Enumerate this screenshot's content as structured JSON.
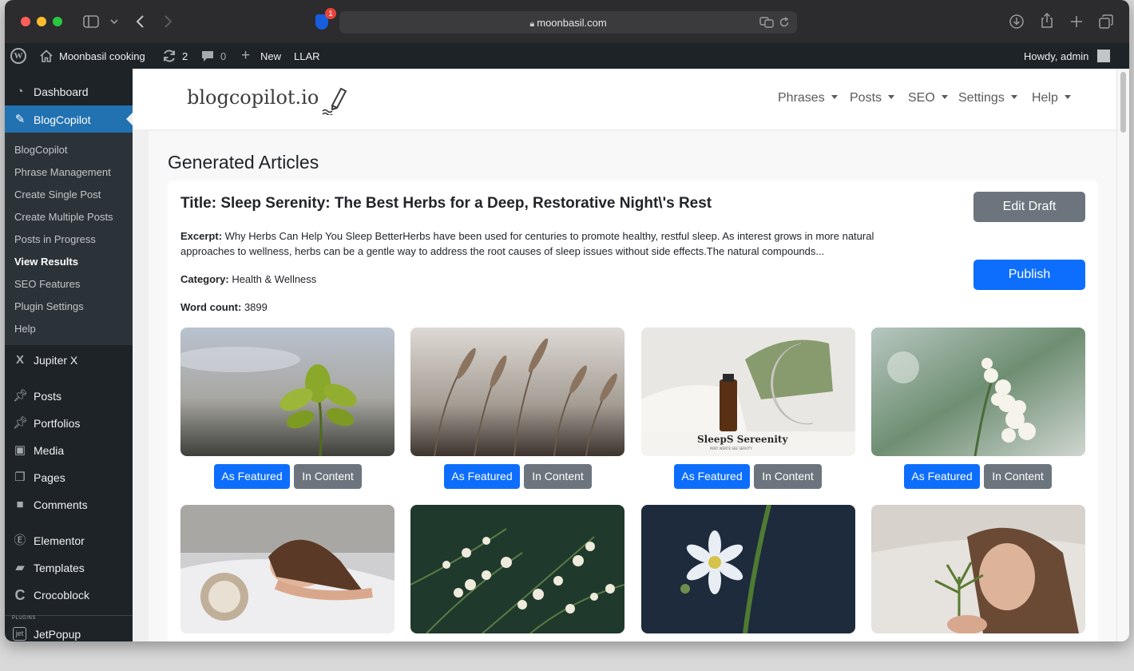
{
  "browser": {
    "url": "moonbasil.com",
    "bitwarden_badge": "1",
    "icons": [
      "sidebar-icon",
      "chevron-down-icon",
      "back-icon",
      "forward-icon",
      "lock-icon",
      "translate-icon",
      "reload-icon",
      "download-icon",
      "share-icon",
      "new-tab-icon",
      "tabs-icon"
    ]
  },
  "adminbar": {
    "site_name": "Moonbasil cooking",
    "updates_count": "2",
    "comments_count": "0",
    "new_label": "New",
    "llar_label": "LLAR",
    "howdy": "Howdy, admin"
  },
  "sidebar": {
    "dashboard": "Dashboard",
    "blogcopilot": "BlogCopilot",
    "submenu": [
      "BlogCopilot",
      "Phrase Management",
      "Create Single Post",
      "Create Multiple Posts",
      "Posts in Progress",
      "View Results",
      "SEO Features",
      "Plugin Settings",
      "Help"
    ],
    "jupiter": "Jupiter X",
    "posts": "Posts",
    "portfolios": "Portfolios",
    "media": "Media",
    "pages": "Pages",
    "comments": "Comments",
    "elementor": "Elementor",
    "templates": "Templates",
    "crocoblock": "Crocoblock",
    "plugins_tag": "PLUGINS",
    "jetpopup": "JetPopup"
  },
  "topnav": {
    "brand": "blogcopilot.io",
    "links": [
      "Phrases",
      "Posts",
      "SEO",
      "Settings",
      "Help"
    ]
  },
  "main": {
    "page_title": "Generated Articles",
    "article": {
      "title": "Title: Sleep Serenity: The Best Herbs for a Deep, Restorative Night\\'s Rest",
      "excerpt_label": "Excerpt:",
      "excerpt": "Why Herbs Can Help You Sleep BetterHerbs have been used for centuries to promote healthy, restful sleep. As interest grows in more natural approaches to wellness, herbs can be a gentle way to address the root causes of sleep issues without side effects.The natural compounds...",
      "category_label": "Category:",
      "category": "Health & Wellness",
      "wordcount_label": "Word count:",
      "wordcount": "3899",
      "edit_draft": "Edit Draft",
      "publish": "Publish"
    },
    "image_buttons": {
      "featured": "As Featured",
      "content": "In Content"
    },
    "images": [
      {
        "name": "green-leaf-sky-image"
      },
      {
        "name": "grass-plumes-image"
      },
      {
        "name": "oil-bottle-moon-image",
        "caption": "SleepS Sereenity",
        "subcaption": "PENT WENTE SEE SERVITY"
      },
      {
        "name": "white-flowers-image"
      },
      {
        "name": "woman-sleeping-clock-image"
      },
      {
        "name": "white-blossoms-image"
      },
      {
        "name": "chamomile-flower-image"
      },
      {
        "name": "woman-leaf-pillow-image"
      }
    ],
    "colors": {
      "primary": "#0d6efd",
      "secondary": "#6c757d",
      "wp_active": "#2271b1",
      "wp_dark": "#1d2327"
    }
  }
}
